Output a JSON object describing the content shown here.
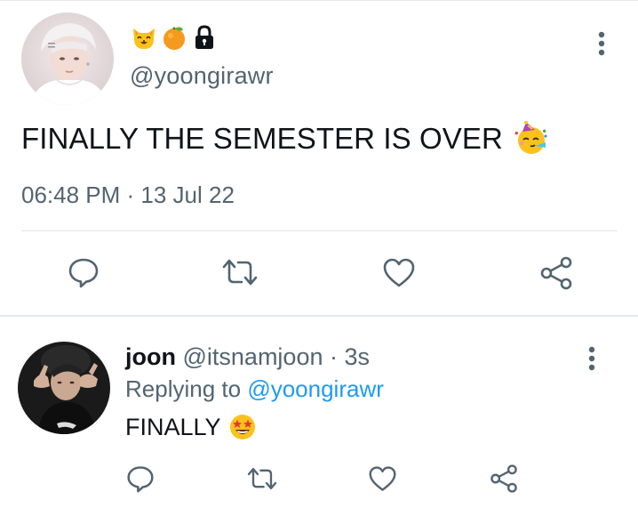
{
  "main_tweet": {
    "badges": [
      "cat-face-emoji",
      "tangerine-emoji",
      "lock-icon"
    ],
    "handle": "@yoongirawr",
    "text": "FINALLY THE SEMESTER IS OVER",
    "text_emoji": "partying-face-emoji",
    "timestamp": "06:48 PM · 13 Jul 22",
    "actions": [
      "reply-icon",
      "retweet-icon",
      "like-icon",
      "share-icon"
    ]
  },
  "reply_tweet": {
    "name": "joon",
    "handle": "@itsnamjoon",
    "separator": " · ",
    "time": "3s",
    "replying_prefix": "Replying to ",
    "replying_to": "@yoongirawr",
    "text": "FINALLY",
    "text_emoji": "star-struck-emoji",
    "actions": [
      "reply-icon",
      "retweet-icon",
      "like-icon",
      "share-icon"
    ]
  },
  "colors": {
    "text": "#0f1419",
    "secondary": "#536471",
    "link": "#1d9bf0",
    "divider": "#e6e9eb"
  }
}
